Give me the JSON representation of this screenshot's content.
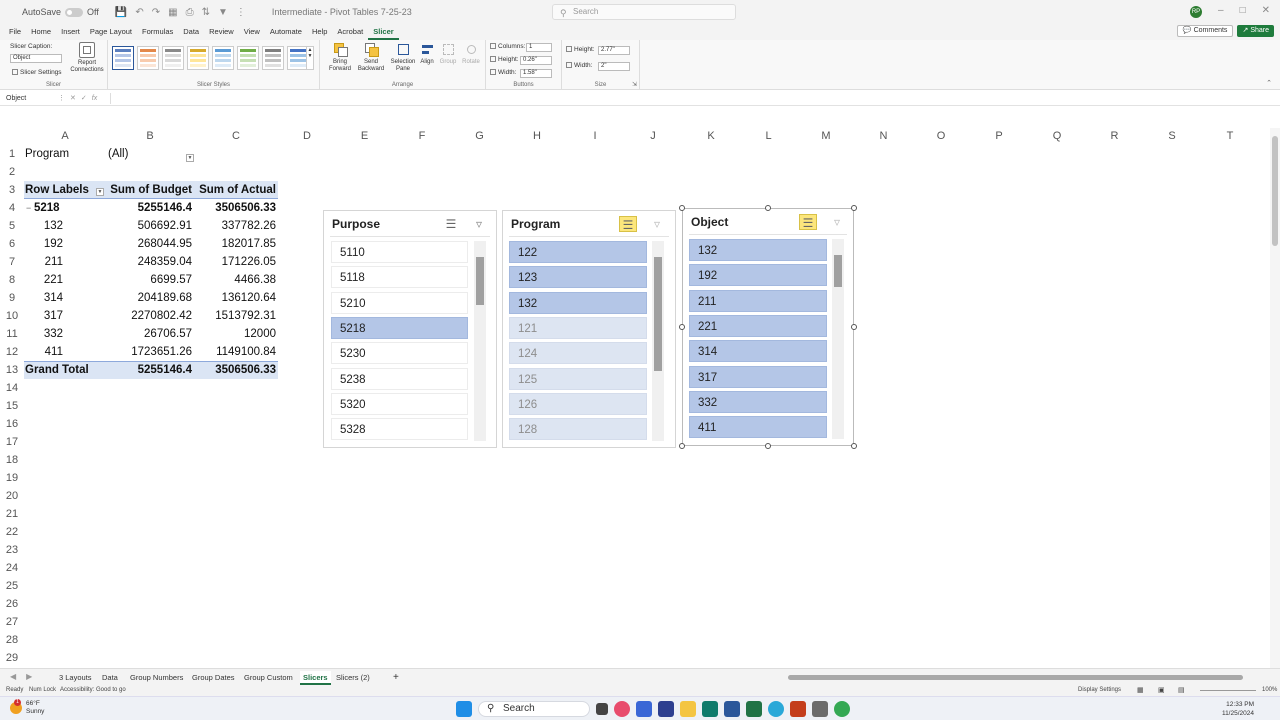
{
  "titlebar": {
    "autosave_label": "AutoSave",
    "autosave_state": "Off",
    "filename": "Intermediate - Pivot Tables 7-25-23",
    "search_placeholder": "Search",
    "avatar_initials": "RP"
  },
  "menu": {
    "items": [
      "File",
      "Home",
      "Insert",
      "Page Layout",
      "Formulas",
      "Data",
      "Review",
      "View",
      "Automate",
      "Help",
      "Acrobat",
      "Slicer"
    ],
    "active": "Slicer",
    "comments_label": "Comments",
    "share_label": "Share"
  },
  "ribbon": {
    "slicer_caption_label": "Slicer Caption:",
    "slicer_caption_value": "Object",
    "slicer_settings_label": "Slicer Settings",
    "report_connections_label": "Report Connections",
    "group_slicer": "Slicer",
    "group_styles": "Slicer Styles",
    "bring_forward": "Bring Forward",
    "send_backward": "Send Backward",
    "selection_pane": "Selection Pane",
    "align": "Align",
    "group": "Group",
    "rotate": "Rotate",
    "group_arrange": "Arrange",
    "columns_label": "Columns:",
    "columns_value": "1",
    "btn_height_label": "Height:",
    "btn_height_value": "0.26\"",
    "btn_width_label": "Width:",
    "btn_width_value": "1.58\"",
    "group_buttons": "Buttons",
    "size_height_label": "Height:",
    "size_height_value": "2.77\"",
    "size_width_label": "Width:",
    "size_width_value": "2\"",
    "group_size": "Size",
    "accent_color": "#217346"
  },
  "formula_bar": {
    "name_box": "Object",
    "fx": "fx"
  },
  "columns": [
    "A",
    "B",
    "C",
    "D",
    "E",
    "F",
    "G",
    "H",
    "I",
    "J",
    "K",
    "L",
    "M",
    "N",
    "O",
    "P",
    "Q",
    "R",
    "S",
    "T"
  ],
  "rows": [
    "1",
    "2",
    "3",
    "4",
    "5",
    "6",
    "7",
    "8",
    "9",
    "10",
    "11",
    "12",
    "13",
    "14",
    "15",
    "16",
    "17",
    "18",
    "19",
    "20",
    "21",
    "22",
    "23",
    "24",
    "25",
    "26",
    "27",
    "28",
    "29"
  ],
  "pivot": {
    "filter_label": "Program",
    "filter_value": "(All)",
    "headers": [
      "Row Labels",
      "Sum of Budget",
      "Sum of Actual"
    ],
    "expand_symbol": "−",
    "group": {
      "label": "5218",
      "budget": "5255146.4",
      "actual": "3506506.33"
    },
    "items": [
      {
        "label": "132",
        "budget": "506692.91",
        "actual": "337782.26"
      },
      {
        "label": "192",
        "budget": "268044.95",
        "actual": "182017.85"
      },
      {
        "label": "211",
        "budget": "248359.04",
        "actual": "171226.05"
      },
      {
        "label": "221",
        "budget": "6699.57",
        "actual": "4466.38"
      },
      {
        "label": "314",
        "budget": "204189.68",
        "actual": "136120.64"
      },
      {
        "label": "317",
        "budget": "2270802.42",
        "actual": "1513792.31"
      },
      {
        "label": "332",
        "budget": "26706.57",
        "actual": "12000"
      },
      {
        "label": "411",
        "budget": "1723651.26",
        "actual": "1149100.84"
      }
    ],
    "total": {
      "label": "Grand Total",
      "budget": "5255146.4",
      "actual": "3506506.33"
    }
  },
  "slicers": {
    "purpose": {
      "title": "Purpose",
      "items": [
        {
          "label": "5110",
          "state": "unsel"
        },
        {
          "label": "5118",
          "state": "unsel"
        },
        {
          "label": "5210",
          "state": "unsel"
        },
        {
          "label": "5218",
          "state": "sel"
        },
        {
          "label": "5230",
          "state": "unsel"
        },
        {
          "label": "5238",
          "state": "unsel"
        },
        {
          "label": "5320",
          "state": "unsel"
        },
        {
          "label": "5328",
          "state": "unsel"
        }
      ]
    },
    "program": {
      "title": "Program",
      "items": [
        {
          "label": "122",
          "state": "sel"
        },
        {
          "label": "123",
          "state": "sel"
        },
        {
          "label": "132",
          "state": "sel"
        },
        {
          "label": "121",
          "state": "nodata"
        },
        {
          "label": "124",
          "state": "nodata"
        },
        {
          "label": "125",
          "state": "nodata"
        },
        {
          "label": "126",
          "state": "nodata"
        },
        {
          "label": "128",
          "state": "nodata"
        }
      ]
    },
    "object": {
      "title": "Object",
      "items": [
        {
          "label": "132",
          "state": "sel"
        },
        {
          "label": "192",
          "state": "sel"
        },
        {
          "label": "211",
          "state": "sel"
        },
        {
          "label": "221",
          "state": "sel"
        },
        {
          "label": "314",
          "state": "sel"
        },
        {
          "label": "317",
          "state": "sel"
        },
        {
          "label": "332",
          "state": "sel"
        },
        {
          "label": "411",
          "state": "sel"
        }
      ]
    },
    "colors": {
      "selected": "#b4c6e7",
      "nodata": "#dde5f2",
      "multiselect": "#fce67c"
    }
  },
  "sheets": {
    "tabs": [
      "3 Layouts",
      "Data",
      "Group Numbers",
      "Group Dates",
      "Group Custom",
      "Slicers",
      "Slicers (2)"
    ],
    "active": "Slicers",
    "add_label": "+"
  },
  "status": {
    "ready": "Ready",
    "num_lock": "Num Lock",
    "accessibility": "Accessibility: Good to go",
    "display_settings": "Display Settings",
    "zoom": "100%"
  },
  "taskbar": {
    "temp": "66°F",
    "weather": "Sunny",
    "weather_badge": "1",
    "search_label": "Search",
    "time": "12:33 PM",
    "date": "11/25/2024"
  }
}
